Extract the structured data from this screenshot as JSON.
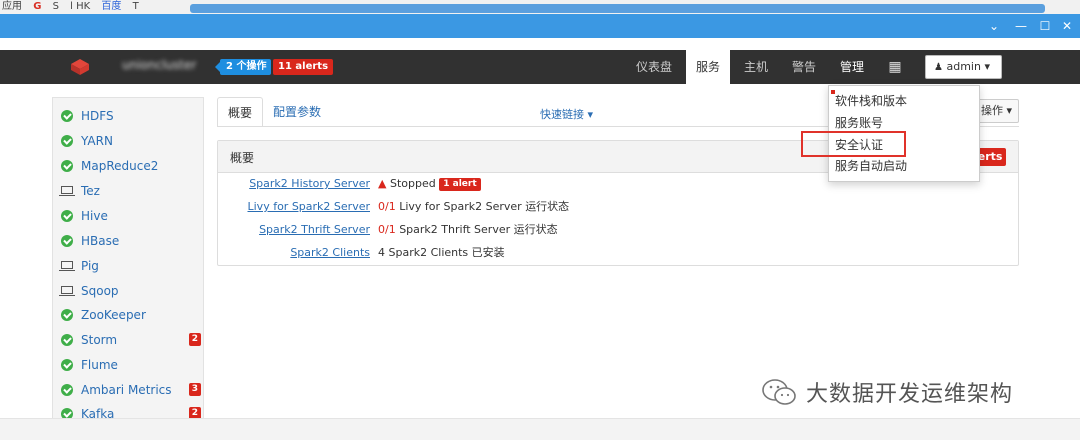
{
  "browser": {
    "bookmark_labels": [
      "应用",
      "G",
      "S",
      "l HK",
      "百度",
      "T"
    ]
  },
  "window": {
    "controls": [
      "chevron-down",
      "minimize",
      "maximize",
      "close"
    ]
  },
  "topnav": {
    "ops_badge": "2 个操作",
    "alerts_badge": "11 alerts",
    "items": [
      {
        "label": "仪表盘",
        "active": false
      },
      {
        "label": "服务",
        "active": true
      },
      {
        "label": "主机",
        "active": false
      },
      {
        "label": "警告",
        "active": false
      },
      {
        "label": "管理",
        "active": false
      }
    ],
    "user_label": "admin"
  },
  "sidebar": {
    "services": [
      {
        "name": "HDFS",
        "status": "ok",
        "alerts": ""
      },
      {
        "name": "YARN",
        "status": "ok",
        "alerts": ""
      },
      {
        "name": "MapReduce2",
        "status": "ok",
        "alerts": ""
      },
      {
        "name": "Tez",
        "status": "client",
        "alerts": ""
      },
      {
        "name": "Hive",
        "status": "ok",
        "alerts": ""
      },
      {
        "name": "HBase",
        "status": "ok",
        "alerts": ""
      },
      {
        "name": "Pig",
        "status": "client",
        "alerts": ""
      },
      {
        "name": "Sqoop",
        "status": "client",
        "alerts": ""
      },
      {
        "name": "ZooKeeper",
        "status": "ok",
        "alerts": ""
      },
      {
        "name": "Storm",
        "status": "ok",
        "alerts": "2"
      },
      {
        "name": "Flume",
        "status": "ok",
        "alerts": ""
      },
      {
        "name": "Ambari Metrics",
        "status": "ok",
        "alerts": "3"
      },
      {
        "name": "Kafka",
        "status": "ok",
        "alerts": "2"
      }
    ]
  },
  "main": {
    "tabs": [
      {
        "label": "概要",
        "active": true
      },
      {
        "label": "配置参数",
        "active": false
      }
    ],
    "quick_links": "快速链接",
    "actions_label": "操作",
    "panel_title": "概要",
    "panel_alerts": "lerts",
    "components": [
      {
        "name": "Spark2 History Server",
        "prefix": "Stopped",
        "count": "",
        "status": "",
        "alert": "1 alert"
      },
      {
        "name": "Livy for Spark2 Server",
        "prefix": "",
        "count": "0/1",
        "status": "Livy for Spark2 Server 运行状态",
        "alert": ""
      },
      {
        "name": "Spark2 Thrift Server",
        "prefix": "",
        "count": "0/1",
        "status": "Spark2 Thrift Server 运行状态",
        "alert": ""
      },
      {
        "name": "Spark2 Clients",
        "prefix": "",
        "count": "",
        "status": "4 Spark2 Clients 已安装",
        "alert": ""
      }
    ]
  },
  "dropdown": {
    "items": [
      "软件栈和版本",
      "服务账号",
      "安全认证",
      "服务自动启动"
    ],
    "highlighted_index": 2
  },
  "watermark": {
    "text": "大数据开发运维架构"
  },
  "colors": {
    "titlebar": "#3b98e3",
    "topnav": "#313131",
    "link": "#2a6db3",
    "alert": "#d9271c",
    "ok": "#3fae49",
    "highlight": "#e0322a"
  }
}
